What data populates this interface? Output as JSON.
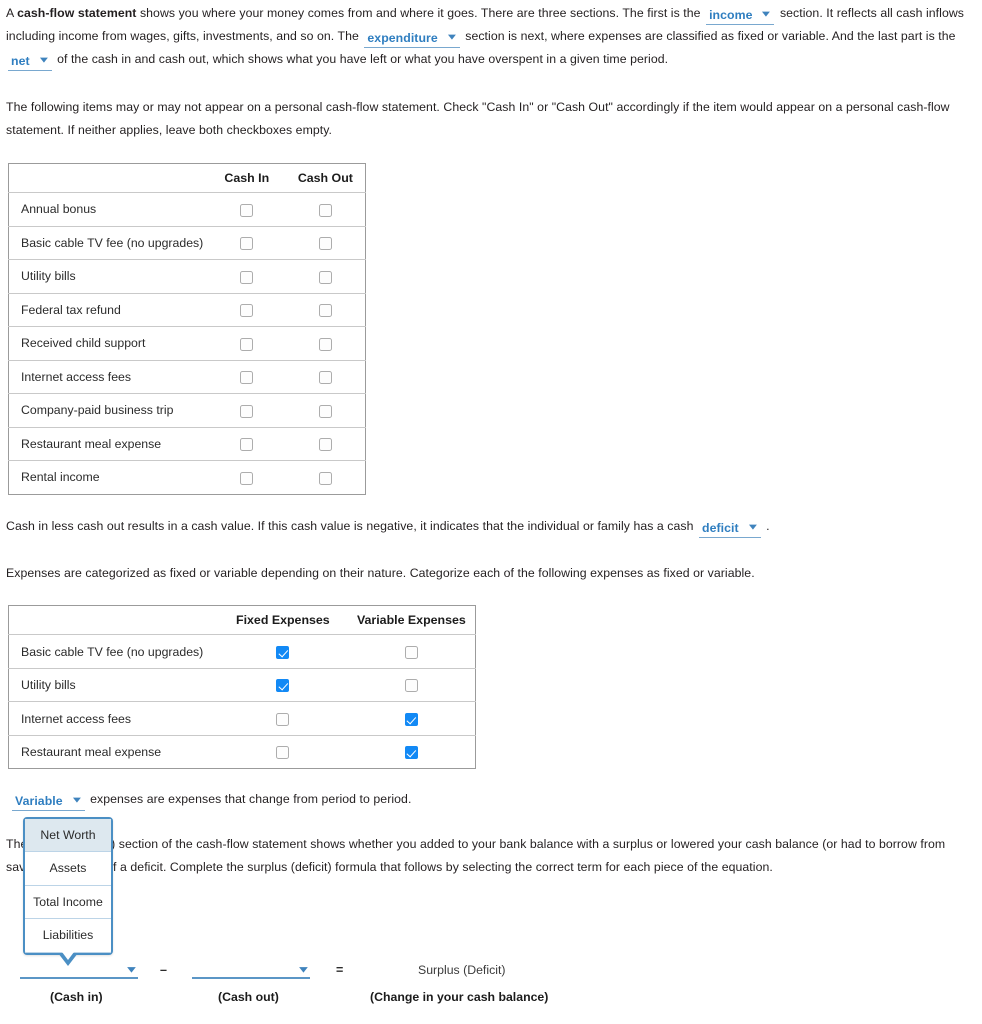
{
  "intro": {
    "p1_a": "A ",
    "p1_bold": "cash-flow statement",
    "p1_b": " shows you where your money comes from and where it goes. There are three sections. The first is the",
    "dd_income": "income",
    "p1_c": "section. It reflects all cash inflows including income from wages, gifts, investments, and so on. The",
    "dd_expenditure": "expenditure",
    "p1_d": "section is next, where expenses are classified as fixed or variable. And the last part is the",
    "dd_net": "net",
    "p1_e": "of the cash in and cash out, which shows what you have left or what you have overspent in a given time period."
  },
  "instructions": {
    "p2": "The following items may or may not appear on a personal cash-flow statement. Check \"Cash In\" or \"Cash Out\" accordingly if the item would appear on a personal cash-flow statement. If neither applies, leave both checkboxes empty."
  },
  "table_cash_flow": {
    "headers": [
      "",
      "Cash In",
      "Cash Out"
    ],
    "rows": [
      {
        "label": "Annual bonus",
        "cash_in": false,
        "cash_out": false
      },
      {
        "label": "Basic cable TV fee (no upgrades)",
        "cash_in": false,
        "cash_out": false
      },
      {
        "label": "Utility bills",
        "cash_in": false,
        "cash_out": false
      },
      {
        "label": "Federal tax refund",
        "cash_in": false,
        "cash_out": false
      },
      {
        "label": "Received child support",
        "cash_in": false,
        "cash_out": false
      },
      {
        "label": "Internet access fees",
        "cash_in": false,
        "cash_out": false
      },
      {
        "label": "Company-paid business trip",
        "cash_in": false,
        "cash_out": false
      },
      {
        "label": "Restaurant meal expense",
        "cash_in": false,
        "cash_out": false
      },
      {
        "label": "Rental income",
        "cash_in": false,
        "cash_out": false
      }
    ]
  },
  "deficit_para": {
    "a": "Cash in less cash out results in a cash value. If this cash value is negative, it indicates that the individual or family has a cash",
    "dd_deficit": "deficit",
    "b": "."
  },
  "expense_intro": "Expenses are categorized as fixed or variable depending on their nature. Categorize each of the following expenses as fixed or variable.",
  "table_expense_type": {
    "headers": [
      "",
      "Fixed Expenses",
      "Variable Expenses"
    ],
    "rows": [
      {
        "label": "Basic cable TV fee (no upgrades)",
        "fixed": true,
        "variable": false
      },
      {
        "label": "Utility bills",
        "fixed": true,
        "variable": false
      },
      {
        "label": "Internet access fees",
        "fixed": false,
        "variable": true
      },
      {
        "label": "Restaurant meal expense",
        "fixed": false,
        "variable": true
      }
    ]
  },
  "variable_para": {
    "dd_variable": "Variable",
    "rest": "expenses are expenses that change from period to period."
  },
  "surplus_para": {
    "text": "The surplus (deficit) section of the cash-flow statement shows whether you added to your bank balance with a surplus or lowered your cash balance (or had to borrow from savings) because of a deficit. Complete the surplus (deficit) formula that follows by selecting the correct term for each piece of the equation."
  },
  "open_dropdown": {
    "options": [
      "Net Worth",
      "Assets",
      "Total Income",
      "Liabilities"
    ],
    "selected": "Net Worth"
  },
  "formula": {
    "minus": "–",
    "equals": "=",
    "result": "Surplus (Deficit)",
    "caption_cash_in": "(Cash in)",
    "caption_cash_out": "(Cash out)",
    "caption_change": "(Change in your cash balance)",
    "blank_value": ""
  },
  "colors": {
    "link": "#2f7ec0",
    "checkbox_checked": "#1289f5",
    "dropdown_border": "#4b8fc4",
    "dropdown_selected_bg": "#dde8ef",
    "blank_underline": "#5b96c6"
  }
}
